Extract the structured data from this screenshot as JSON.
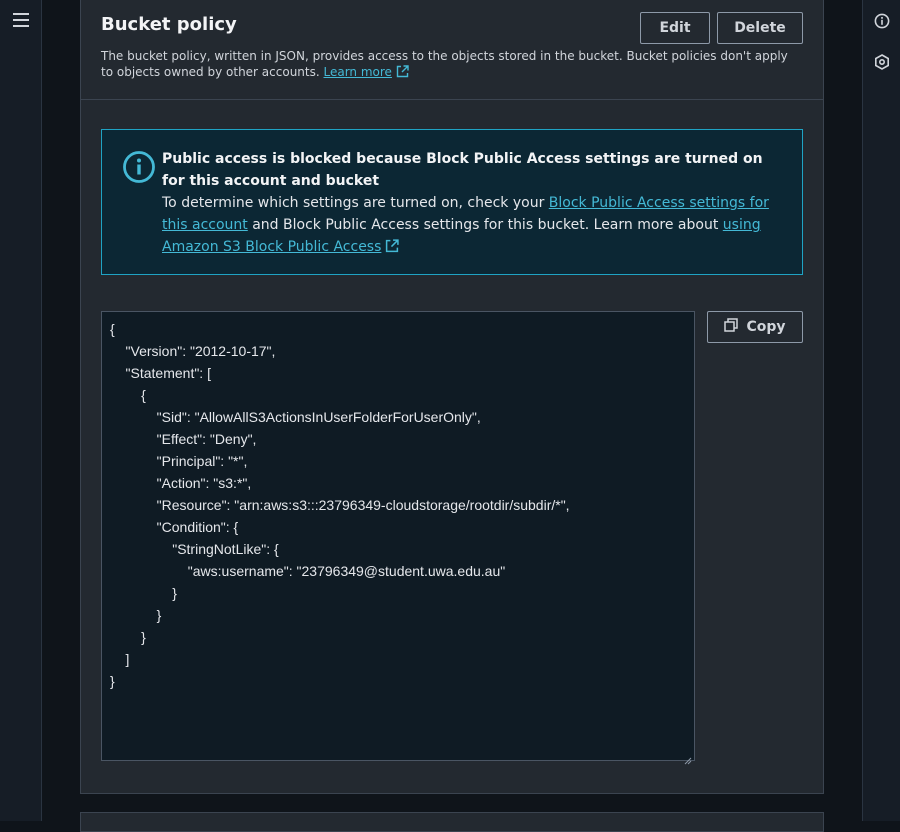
{
  "header": {
    "title": "Bucket policy",
    "description": "The bucket policy, written in JSON, provides access to the objects stored in the bucket. Bucket policies don't apply to objects owned by other accounts.",
    "learn_more": "Learn more",
    "edit_label": "Edit",
    "delete_label": "Delete"
  },
  "alert": {
    "title": "Public access is blocked because Block Public Access settings are turned on for this account and bucket",
    "body_prefix": "To determine which settings are turned on, check your ",
    "link1": "Block Public Access settings for this account",
    "body_middle": " and Block Public Access settings for this bucket. Learn more about ",
    "link2": "using Amazon S3 Block Public Access"
  },
  "policy": {
    "json": "{\n    \"Version\": \"2012-10-17\",\n    \"Statement\": [\n        {\n            \"Sid\": \"AllowAllS3ActionsInUserFolderForUserOnly\",\n            \"Effect\": \"Deny\",\n            \"Principal\": \"*\",\n            \"Action\": \"s3:*\",\n            \"Resource\": \"arn:aws:s3:::23796349-cloudstorage/rootdir/subdir/*\",\n            \"Condition\": {\n                \"StringNotLike\": {\n                    \"aws:username\": \"23796349@student.uwa.edu.au\"\n                }\n            }\n        }\n    ]\n}",
    "copy_label": "Copy"
  },
  "icons": {
    "menu": "menu-icon",
    "info": "info-icon",
    "feedback": "hexagon-icon",
    "external": "external-link-icon",
    "copy": "copy-icon"
  },
  "colors": {
    "link": "#44b9d6",
    "alert_border": "#1fa3c4",
    "alert_bg": "#0c2734"
  }
}
